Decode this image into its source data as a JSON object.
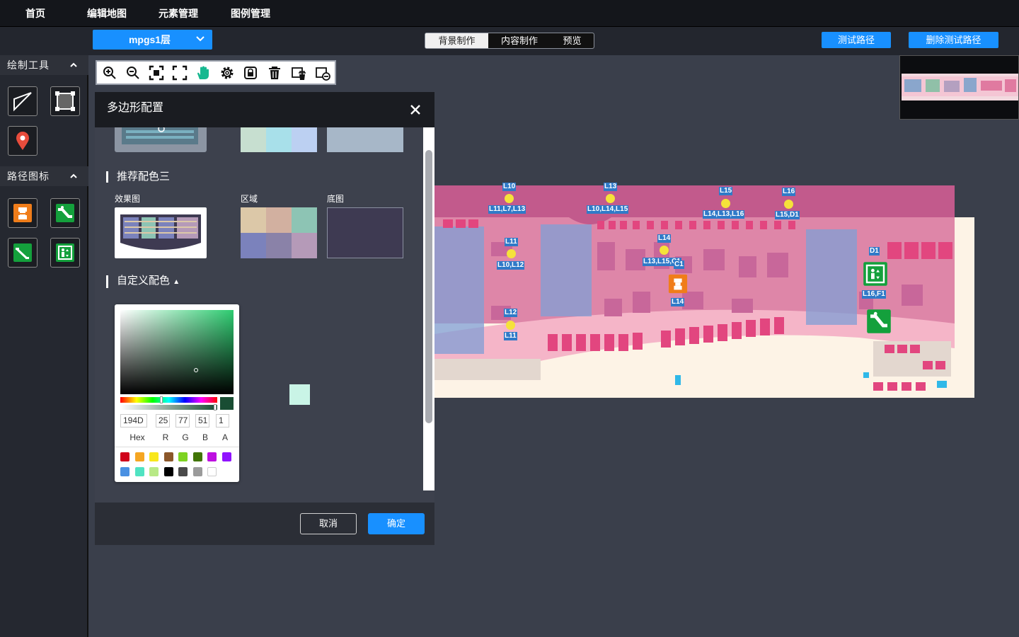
{
  "nav": {
    "home": "首页",
    "edit_map": "编辑地图",
    "elements": "元素管理",
    "legend": "图例管理"
  },
  "floor": {
    "selected": "mpgs1层"
  },
  "modes": {
    "background": "背景制作",
    "content": "内容制作",
    "preview": "预览",
    "active": "内容制作"
  },
  "actions": {
    "test_path": "测试路径",
    "delete_test_path": "删除测试路径"
  },
  "sidebar": {
    "draw_tools": "绘制工具",
    "draw_tool_icons": [
      "line-draw-icon",
      "polygon-draw-icon",
      "location-pin-icon"
    ],
    "path_icons_title": "路径图标",
    "path_icons": [
      "stairs-icon",
      "escalator-up-icon",
      "escalator-down-icon",
      "elevator-icon"
    ]
  },
  "toolbar": {
    "icons": [
      "zoom-in-icon",
      "zoom-out-icon",
      "fit-view-icon",
      "fullscreen-icon",
      "hand-pan-icon",
      "settings-icon",
      "lock-icon",
      "delete-icon",
      "delete-layer-icon",
      "clear-layer-icon"
    ]
  },
  "dialog": {
    "title": "多边形配置",
    "scheme3_title": "推荐配色三",
    "col_effect": "效果图",
    "col_region": "区域",
    "col_base": "底图",
    "custom_title": "自定义配色",
    "cancel": "取消",
    "ok": "确定",
    "preview_color": "#c9f4e6",
    "prev_scheme_colors": [
      "#c7dfd0",
      "#a8e0ea",
      "#bcd0f2",
      "#a7b7c8"
    ],
    "scheme3_colors": [
      "#dcc8a8",
      "#d2b0a0",
      "#8dc4b4",
      "#7b82bc",
      "#8a82a8",
      "#b59ab8"
    ],
    "scheme3_base": "#3e3a52"
  },
  "picker": {
    "hex": "194D",
    "r": "25",
    "g": "77",
    "b": "51",
    "a": "1",
    "labels": {
      "hex": "Hex",
      "r": "R",
      "g": "G",
      "b": "B",
      "a": "A"
    },
    "current": "#194d33",
    "swatches": [
      "#d0021b",
      "#f5a623",
      "#f8e71c",
      "#8b572a",
      "#7ed321",
      "#417505",
      "#bd10e0",
      "#9013fe",
      "#4a90e2",
      "#50e3c2",
      "#b8e986",
      "#000000",
      "#4a4a4a",
      "#9b9b9b",
      "#ffffff"
    ]
  },
  "map": {
    "labels": [
      {
        "id": "L10",
        "sub": "L11,L7,L13"
      },
      {
        "id": "L13",
        "sub": "L10,L14,L15"
      },
      {
        "id": "L15",
        "sub": "L14,L13,L16"
      },
      {
        "id": "L16",
        "sub": "L15,D1"
      },
      {
        "id": "L11",
        "sub": "L10,L12"
      },
      {
        "id": "L14",
        "sub": "L13,L15,C1"
      },
      {
        "id": "C1",
        "sub": "L14"
      },
      {
        "id": "D1",
        "sub": "L16,F1"
      },
      {
        "id": "L12",
        "sub": "L11"
      }
    ]
  }
}
